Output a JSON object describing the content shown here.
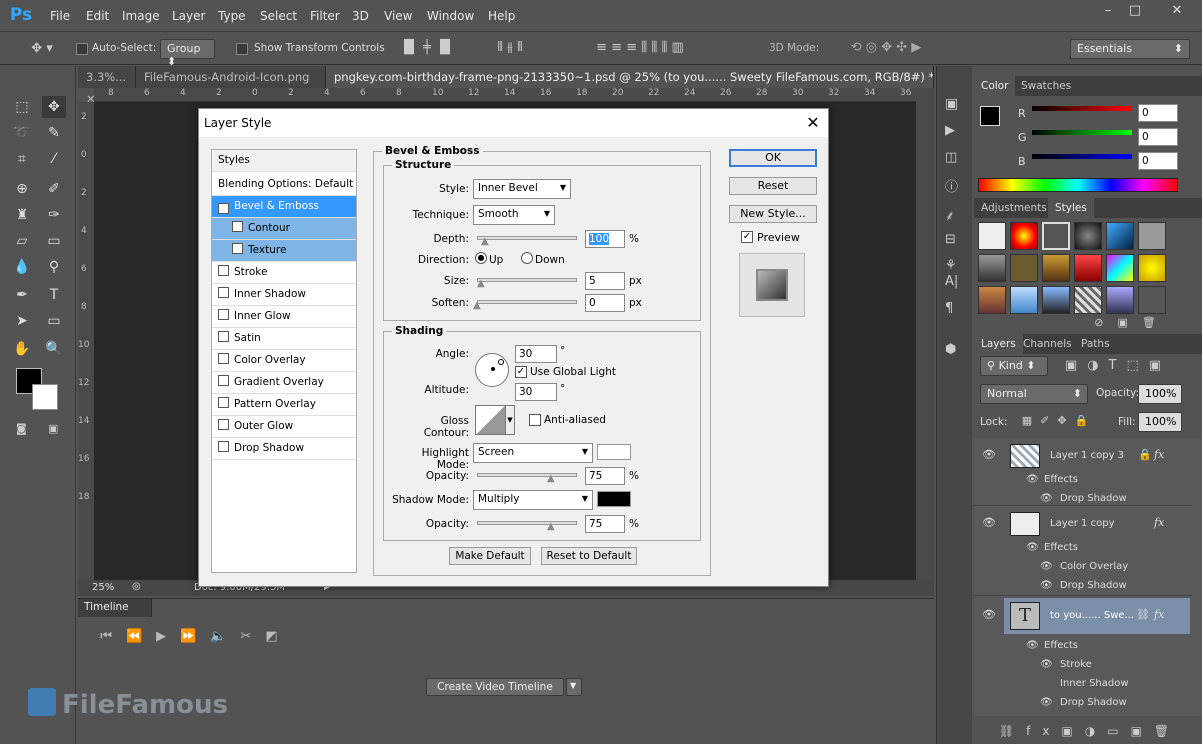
{
  "app": {
    "logo": "Ps"
  },
  "menu": [
    "File",
    "Edit",
    "Image",
    "Layer",
    "Type",
    "Select",
    "Filter",
    "3D",
    "View",
    "Window",
    "Help"
  ],
  "options": {
    "auto_select_label": "Auto-Select:",
    "auto_select_value": "Group",
    "transform_label": "Show Transform Controls",
    "mode3d_label": "3D Mode:",
    "workspace": "Essentials"
  },
  "doc_tabs": [
    {
      "label": "3.3%..."
    },
    {
      "label": "FileFamous-Android-Icon.png"
    },
    {
      "label": "pngkey.com-birthday-frame-png-2133350~1.psd @ 25% (to you...... Sweety FileFamous.com, RGB/8#) *"
    }
  ],
  "ruler_top": [
    "8",
    "6",
    "4",
    "2",
    "0",
    "2",
    "4",
    "6",
    "8",
    "10",
    "12",
    "14",
    "16",
    "18",
    "20",
    "22",
    "24",
    "26",
    "28",
    "30",
    "32",
    "34",
    "36"
  ],
  "ruler_left": [
    "2",
    "0",
    "2",
    "4",
    "6",
    "8",
    "10",
    "12",
    "14",
    "16",
    "18"
  ],
  "status": {
    "zoom": "25%",
    "doc": "Doc: 9.00M/29.5M"
  },
  "timeline": {
    "title": "Timeline",
    "create_btn": "Create Video Timeline"
  },
  "dialog": {
    "title": "Layer Style",
    "styles_header": "Styles",
    "items": [
      {
        "label": "Blending Options: Default",
        "checkbox": false
      },
      {
        "label": "Bevel & Emboss",
        "checkbox": true,
        "checked": "✓",
        "selected": true
      },
      {
        "label": "Contour",
        "checkbox": true,
        "sub": true
      },
      {
        "label": "Texture",
        "checkbox": true,
        "sub": true
      },
      {
        "label": "Stroke",
        "checkbox": true
      },
      {
        "label": "Inner Shadow",
        "checkbox": true
      },
      {
        "label": "Inner Glow",
        "checkbox": true
      },
      {
        "label": "Satin",
        "checkbox": true
      },
      {
        "label": "Color Overlay",
        "checkbox": true
      },
      {
        "label": "Gradient Overlay",
        "checkbox": true
      },
      {
        "label": "Pattern Overlay",
        "checkbox": true
      },
      {
        "label": "Outer Glow",
        "checkbox": true
      },
      {
        "label": "Drop Shadow",
        "checkbox": true
      }
    ],
    "bevel_title": "Bevel & Emboss",
    "structure": {
      "title": "Structure",
      "style_label": "Style:",
      "style_value": "Inner Bevel",
      "technique_label": "Technique:",
      "technique_value": "Smooth",
      "depth_label": "Depth:",
      "depth_value": "100",
      "depth_unit": "%",
      "direction_label": "Direction:",
      "dir_up": "Up",
      "dir_down": "Down",
      "size_label": "Size:",
      "size_value": "5",
      "size_unit": "px",
      "soften_label": "Soften:",
      "soften_value": "0",
      "soften_unit": "px"
    },
    "shading": {
      "title": "Shading",
      "angle_label": "Angle:",
      "angle_value": "30",
      "deg": "°",
      "global_light": "Use Global Light",
      "altitude_label": "Altitude:",
      "altitude_value": "30",
      "gloss_label": "Gloss Contour:",
      "anti_aliased": "Anti-aliased",
      "highlight_label": "Highlight Mode:",
      "highlight_value": "Screen",
      "opacity_label": "Opacity:",
      "hl_opacity": "75",
      "pct": "%",
      "shadow_label": "Shadow Mode:",
      "shadow_value": "Multiply",
      "sh_opacity": "75"
    },
    "make_default": "Make Default",
    "reset_default": "Reset to Default",
    "ok": "OK",
    "reset": "Reset",
    "new_style": "New Style...",
    "preview": "Preview"
  },
  "color_panel": {
    "tabs": [
      "Color",
      "Swatches"
    ],
    "r": "R",
    "g": "G",
    "b": "B",
    "r_val": "0",
    "g_val": "0",
    "b_val": "0"
  },
  "styles_panel": {
    "tabs": [
      "Adjustments",
      "Styles"
    ]
  },
  "layers_panel": {
    "tabs": [
      "Layers",
      "Channels",
      "Paths"
    ],
    "kind": "Kind",
    "blend": "Normal",
    "opacity_label": "Opacity:",
    "opacity": "100%",
    "lock_label": "Lock:",
    "fill_label": "Fill:",
    "fill": "100%",
    "layers": [
      {
        "name": "Layer 1 copy 3",
        "effects": "Effects",
        "fx": [
          "Drop Shadow"
        ]
      },
      {
        "name": "Layer 1 copy",
        "effects": "Effects",
        "fx": [
          "Color Overlay",
          "Drop Shadow"
        ]
      },
      {
        "name": "to you...... Swe...",
        "effects": "Effects",
        "fx": [
          "Stroke",
          "Inner Shadow",
          "Drop Shadow"
        ]
      }
    ]
  },
  "watermark": "FileFamous"
}
